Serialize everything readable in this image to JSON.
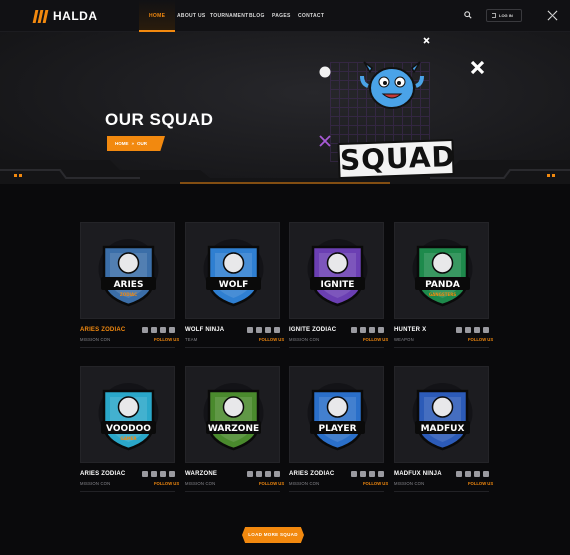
{
  "brand": {
    "name": "HALDA",
    "accent": "#f2890f"
  },
  "nav": {
    "items": [
      "HOME",
      "ABOUT US",
      "TOURNAMENT",
      "BLOG",
      "PAGES",
      "CONTACT"
    ],
    "login_label": "LOG IN"
  },
  "hero": {
    "title": "OUR SQUAD",
    "breadcrumb": [
      "HOME",
      "OUR SQUAD"
    ],
    "badge_text": "SQUAD"
  },
  "members": [
    {
      "name": "ARIES ZODIAC",
      "role": "MISSION CON",
      "follow": "FOLLOW US",
      "highlighted": true,
      "logo_text": "ARIES",
      "logo_tag": "ZODIAC",
      "logo_color": "#3b6ea8"
    },
    {
      "name": "WOLF NINJA",
      "role": "TEAM",
      "follow": "FOLLOW US",
      "highlighted": false,
      "logo_text": "WOLF",
      "logo_tag": "",
      "logo_color": "#2f7fd1"
    },
    {
      "name": "IGNITE ZODIAC",
      "role": "MISSION CON",
      "follow": "FOLLOW US",
      "highlighted": false,
      "logo_text": "IGNITE",
      "logo_tag": "",
      "logo_color": "#6b3fb3"
    },
    {
      "name": "HUNTER X",
      "role": "WEAPON",
      "follow": "FOLLOW US",
      "highlighted": false,
      "logo_text": "PANDA",
      "logo_tag": "GANGSTERS",
      "logo_color": "#1e8a4c"
    },
    {
      "name": "ARIES ZODIAC",
      "role": "MISSION CON",
      "follow": "FOLLOW US",
      "highlighted": false,
      "logo_text": "VOODOO",
      "logo_tag": "GAMER",
      "logo_color": "#2aa7c9"
    },
    {
      "name": "WARZONE",
      "role": "MISSION CON",
      "follow": "FOLLOW US",
      "highlighted": false,
      "logo_text": "WARZONE",
      "logo_tag": "",
      "logo_color": "#4a8a2d"
    },
    {
      "name": "ARIES ZODIAC",
      "role": "MISSION CON",
      "follow": "FOLLOW US",
      "highlighted": false,
      "logo_text": "PLAYER",
      "logo_tag": "",
      "logo_color": "#2a6fc9"
    },
    {
      "name": "MADFUX NINJA",
      "role": "MISSION CON",
      "follow": "FOLLOW US",
      "highlighted": false,
      "logo_text": "MADFUX",
      "logo_tag": "",
      "logo_color": "#2c5bb8"
    }
  ],
  "social_icons": [
    "twitter-icon",
    "facebook-icon",
    "instagram-icon",
    "twitch-icon"
  ],
  "load_more_label": "LOAD MORE SQUAD"
}
